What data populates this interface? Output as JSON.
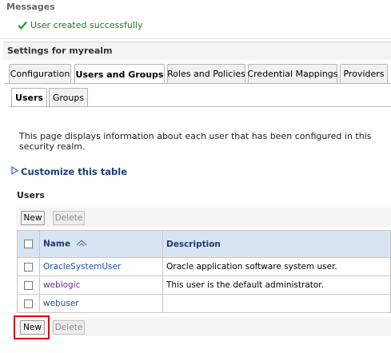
{
  "messages": {
    "title": "Messages",
    "success": "User created successfully"
  },
  "settings": {
    "title": "Settings for myrealm"
  },
  "tabs": [
    {
      "label": "Configuration",
      "active": false
    },
    {
      "label": "Users and Groups",
      "active": true
    },
    {
      "label": "Roles and Policies",
      "active": false
    },
    {
      "label": "Credential Mappings",
      "active": false
    },
    {
      "label": "Providers",
      "active": false
    }
  ],
  "subtabs": [
    {
      "label": "Users",
      "active": true
    },
    {
      "label": "Groups",
      "active": false
    }
  ],
  "description": "This page displays information about each user that has been configured in this security realm.",
  "customize": "Customize this table",
  "users_table": {
    "heading": "Users",
    "new_label": "New",
    "delete_label": "Delete",
    "columns": [
      "Name",
      "Description"
    ],
    "sort_indicator": "sorted-ascending",
    "rows": [
      {
        "name": "OracleSystemUser",
        "description": "Oracle application software system user."
      },
      {
        "name": "weblogic",
        "description": "This user is the default administrator."
      },
      {
        "name": "webuser",
        "description": ""
      }
    ]
  },
  "colors": {
    "success": "#1e7a1e",
    "link": "#1f4fa0",
    "visited_link": "#6c2f7d",
    "header_bg": "#d9e4f2",
    "highlight": "#cc1111"
  }
}
